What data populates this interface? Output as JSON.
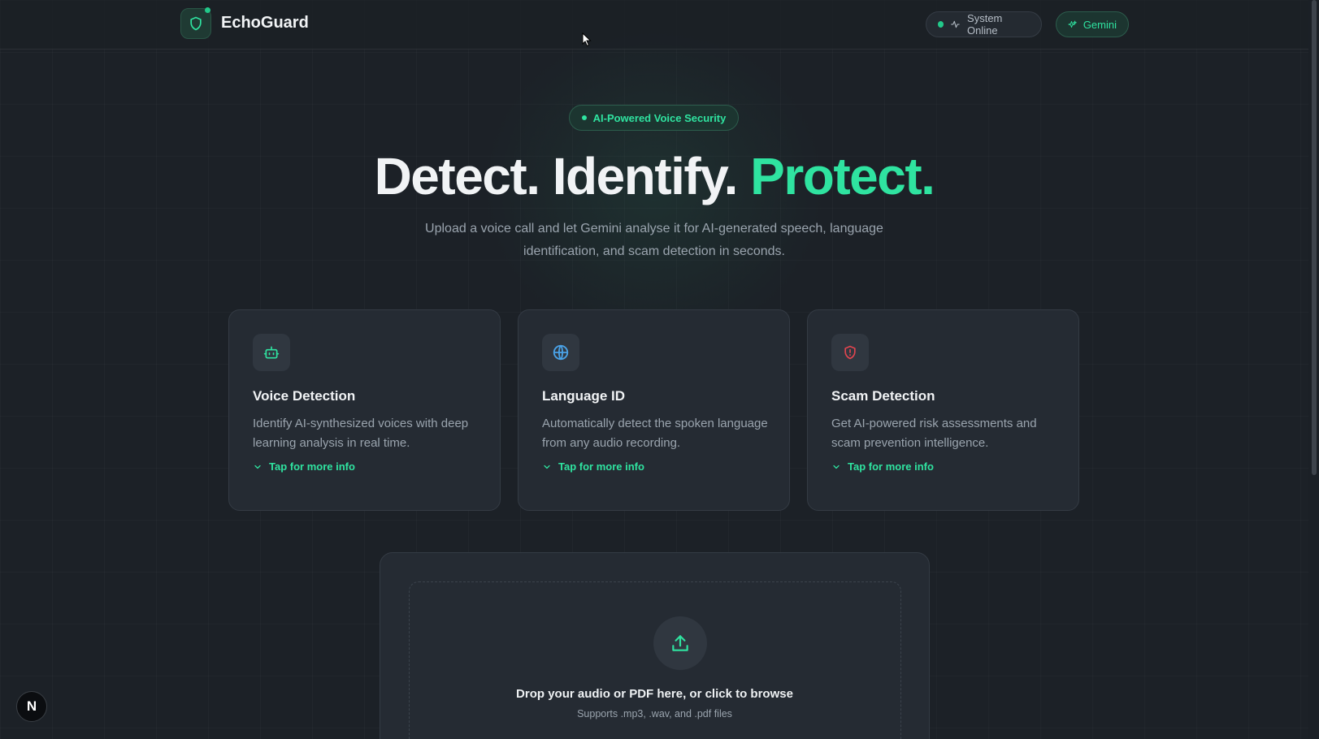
{
  "header": {
    "brand": "EchoGuard",
    "status_label": "System Online",
    "gemini_label": "Gemini"
  },
  "hero": {
    "badge": "AI-Powered Voice Security",
    "headline_part1": "Detect. Identify. ",
    "headline_accent": "Protect.",
    "subtitle": "Upload a voice call and let Gemini analyse it for AI-generated speech, language identification, and scam detection in seconds."
  },
  "cards": [
    {
      "title": "Voice Detection",
      "description": "Identify AI-synthesized voices with deep learning analysis in real time.",
      "more_label": "Tap for more info",
      "icon": "robot-icon"
    },
    {
      "title": "Language ID",
      "description": "Automatically detect the spoken language from any audio recording.",
      "more_label": "Tap for more info",
      "icon": "globe-icon"
    },
    {
      "title": "Scam Detection",
      "description": "Get AI-powered risk assessments and scam prevention intelligence.",
      "more_label": "Tap for more info",
      "icon": "shield-alert-icon"
    }
  ],
  "upload": {
    "prompt": "Drop your audio or PDF here, or click to browse",
    "supported": "Supports .mp3, .wav, and .pdf files"
  },
  "floating_badge": "N",
  "colors": {
    "accent": "#2fe3a0",
    "background": "#1c2127",
    "card": "#252b33",
    "alert": "#e0454f",
    "info": "#4aa3e8"
  }
}
